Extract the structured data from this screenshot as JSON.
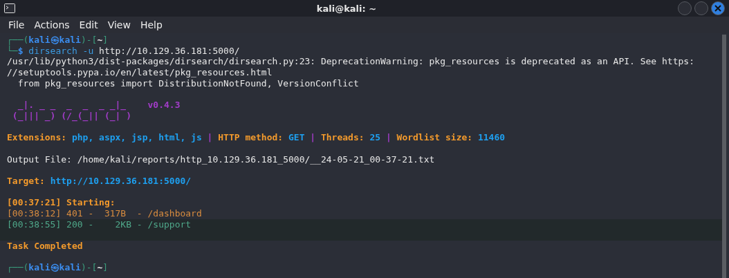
{
  "window": {
    "title": "kali@kali: ~"
  },
  "menu": [
    "File",
    "Actions",
    "Edit",
    "View",
    "Help"
  ],
  "lines": [
    {
      "kind": "text",
      "segments": [
        {
          "kind": "frame",
          "text": "┌──("
        },
        {
          "kind": "prompt",
          "text": "kali㉿kali"
        },
        {
          "kind": "frame",
          "text": ")-["
        },
        {
          "kind": "path",
          "text": "~"
        },
        {
          "kind": "frame",
          "text": "]"
        }
      ]
    },
    {
      "kind": "text",
      "segments": [
        {
          "kind": "frame",
          "text": "└─"
        },
        {
          "kind": "prompt",
          "text": "$ "
        },
        {
          "kind": "command",
          "text": "dirsearch -u "
        },
        {
          "kind": "plain",
          "text": "http://10.129.36.181:5000/"
        }
      ]
    },
    {
      "kind": "text",
      "segments": [
        {
          "kind": "plain",
          "text": "/usr/lib/python3/dist-packages/dirsearch/dirsearch.py:23: DeprecationWarning: pkg_resources is deprecated as an API. See https:"
        }
      ]
    },
    {
      "kind": "text",
      "segments": [
        {
          "kind": "plain",
          "text": "//setuptools.pypa.io/en/latest/pkg_resources.html"
        }
      ]
    },
    {
      "kind": "text",
      "segments": [
        {
          "kind": "plain",
          "text": "  from pkg_resources import DistributionNotFound, VersionConflict"
        }
      ]
    },
    {
      "kind": "blank"
    },
    {
      "kind": "text",
      "segments": [
        {
          "kind": "banner",
          "text": "  _|. _ _  _  _  _ _|_    v0.4.3"
        }
      ]
    },
    {
      "kind": "text",
      "segments": [
        {
          "kind": "banner",
          "text": " (_||| _) (/_(_|| (_| )"
        }
      ]
    },
    {
      "kind": "blank"
    },
    {
      "kind": "text",
      "segments": [
        {
          "kind": "label",
          "text": "Extensions: "
        },
        {
          "kind": "value",
          "text": "php, aspx, jsp, html, js"
        },
        {
          "kind": "sep",
          "text": " | "
        },
        {
          "kind": "label",
          "text": "HTTP method: "
        },
        {
          "kind": "value",
          "text": "GET"
        },
        {
          "kind": "sep",
          "text": " | "
        },
        {
          "kind": "label",
          "text": "Threads: "
        },
        {
          "kind": "value",
          "text": "25"
        },
        {
          "kind": "sep",
          "text": " | "
        },
        {
          "kind": "label",
          "text": "Wordlist size: "
        },
        {
          "kind": "value",
          "text": "11460"
        }
      ]
    },
    {
      "kind": "blank"
    },
    {
      "kind": "text",
      "segments": [
        {
          "kind": "plain",
          "text": "Output File: /home/kali/reports/http_10.129.36.181_5000/__24-05-21_00-37-21.txt"
        }
      ]
    },
    {
      "kind": "blank"
    },
    {
      "kind": "text",
      "segments": [
        {
          "kind": "label",
          "text": "Target: "
        },
        {
          "kind": "value",
          "text": "http://10.129.36.181:5000/"
        }
      ]
    },
    {
      "kind": "blank"
    },
    {
      "kind": "text",
      "segments": [
        {
          "kind": "label",
          "text": "[00:37:21] Starting:"
        }
      ]
    },
    {
      "kind": "text",
      "segments": [
        {
          "kind": "warn",
          "text": "[00:38:12] 401 -  317B  - /dashboard"
        }
      ]
    },
    {
      "kind": "text",
      "highlighted": true,
      "segments": [
        {
          "kind": "ok",
          "text": "[00:38:55] 200 -    2KB - /support"
        }
      ]
    },
    {
      "kind": "blank",
      "highlighted": true
    },
    {
      "kind": "text",
      "segments": [
        {
          "kind": "label",
          "text": "Task Completed"
        }
      ]
    },
    {
      "kind": "blank"
    },
    {
      "kind": "text",
      "segments": [
        {
          "kind": "frame",
          "text": "┌──("
        },
        {
          "kind": "prompt",
          "text": "kali㉿kali"
        },
        {
          "kind": "frame",
          "text": ")-["
        },
        {
          "kind": "path",
          "text": "~"
        },
        {
          "kind": "frame",
          "text": "]"
        }
      ]
    }
  ]
}
